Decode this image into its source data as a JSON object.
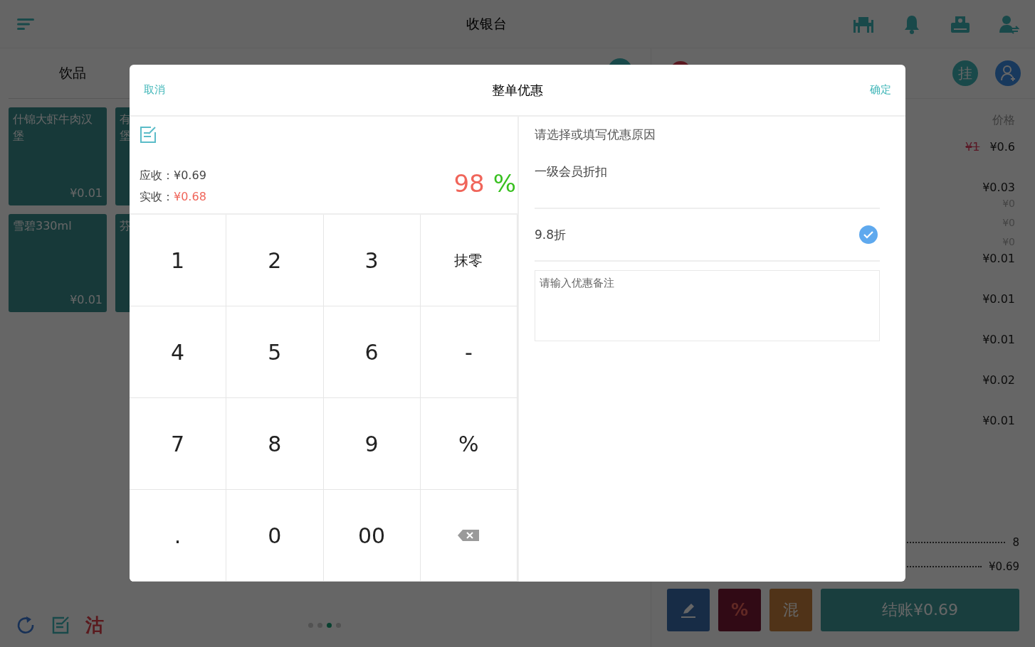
{
  "topbar": {
    "title": "收银台"
  },
  "category_tab": "饮品",
  "products": [
    {
      "kind": "full",
      "name": "什锦大虾牛肉汉堡",
      "price": "¥0.01"
    },
    {
      "kind": "partial",
      "name": "有堡"
    },
    {
      "kind": "full",
      "name": "雪碧330ml",
      "price": "¥0.01"
    },
    {
      "kind": "partial",
      "name": "芬"
    }
  ],
  "sold_out_label": "沽",
  "page_dots": [
    {
      "selected": false
    },
    {
      "selected": false
    },
    {
      "selected": true
    },
    {
      "selected": false
    }
  ],
  "order_panel": {
    "hang_button": "挂",
    "price_header": "价格",
    "prices": [
      {
        "original": "¥1",
        "price": "¥0.6"
      },
      {
        "price": "¥0.03",
        "subs": [
          "¥0",
          "¥0",
          "¥0"
        ]
      },
      {
        "price": "¥0.01"
      },
      {
        "price": "¥0.01"
      },
      {
        "price": "¥0.01"
      },
      {
        "price": "¥0.02"
      },
      {
        "price": "¥0.01"
      }
    ],
    "summary": [
      "8",
      "¥0.69"
    ],
    "discount_button": "%",
    "mixed_button": "混",
    "checkout_button": "结账¥0.69"
  },
  "dialog": {
    "cancel": "取消",
    "title": "整单优惠",
    "confirm": "确定",
    "receivable_label": "应收：",
    "receivable": "¥0.69",
    "received_label": "实收：",
    "received": "¥0.68",
    "discount_value": "98",
    "discount_unit": "%",
    "keys": [
      {
        "kind": "text",
        "label": "1"
      },
      {
        "kind": "text",
        "label": "2"
      },
      {
        "kind": "text",
        "label": "3"
      },
      {
        "kind": "text",
        "label": "抹零"
      },
      {
        "kind": "text",
        "label": "4"
      },
      {
        "kind": "text",
        "label": "5"
      },
      {
        "kind": "text",
        "label": "6"
      },
      {
        "kind": "text",
        "label": "-"
      },
      {
        "kind": "text",
        "label": "7"
      },
      {
        "kind": "text",
        "label": "8"
      },
      {
        "kind": "text",
        "label": "9"
      },
      {
        "kind": "text",
        "label": "%"
      },
      {
        "kind": "text",
        "label": "."
      },
      {
        "kind": "text",
        "label": "0"
      },
      {
        "kind": "text",
        "label": "00"
      },
      {
        "kind": "backspace"
      }
    ],
    "reason_prompt": "请选择或填写优惠原因",
    "reason_groups": [
      {
        "title": "一级会员折扣",
        "options": [
          {
            "label": "9.8折",
            "selected": true
          }
        ]
      }
    ],
    "note_placeholder": "请输入优惠备注"
  }
}
